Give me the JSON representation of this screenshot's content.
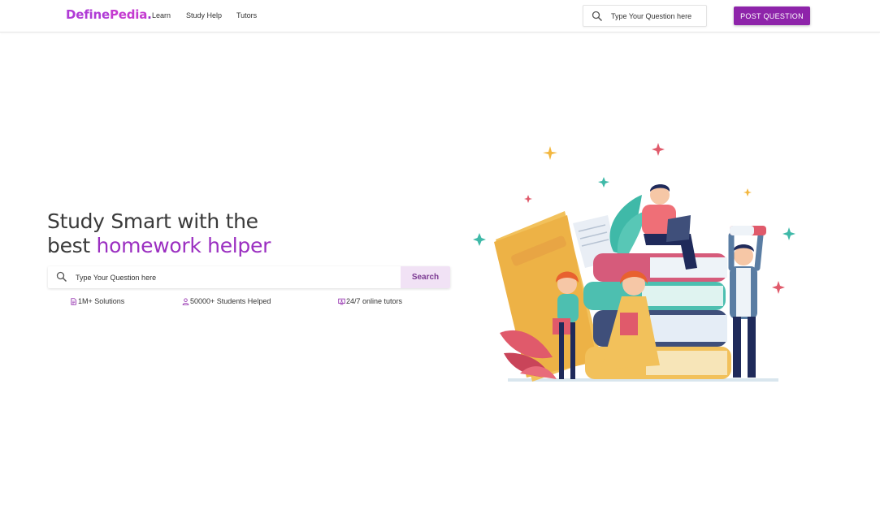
{
  "header": {
    "logo": {
      "part1": "Define",
      "part2": "Pedia",
      "dot": "."
    },
    "nav": [
      {
        "label": "Learn"
      },
      {
        "label": "Study Help"
      },
      {
        "label": "Tutors"
      }
    ],
    "search": {
      "placeholder": "Type Your Question here",
      "icon": "search-icon"
    },
    "post_button": "POST QUESTION"
  },
  "hero": {
    "title_line1": "Study Smart with the",
    "title_line2_prefix": "best ",
    "title_line2_highlight": "homework helper",
    "search": {
      "placeholder": "Type Your Question here",
      "button": "Search",
      "icon": "search-icon"
    },
    "stats": [
      {
        "label": "1M+ Solutions",
        "icon": "document-icon"
      },
      {
        "label": "50000+ Students Helped",
        "icon": "person-icon"
      },
      {
        "label": "24/7 online tutors",
        "icon": "monitor-icon"
      }
    ],
    "illustration": "students-with-books-illustration"
  },
  "colors": {
    "brand": "#9b2fc1",
    "button": "#8e24aa",
    "search_button_bg": "#f1e2f5"
  }
}
